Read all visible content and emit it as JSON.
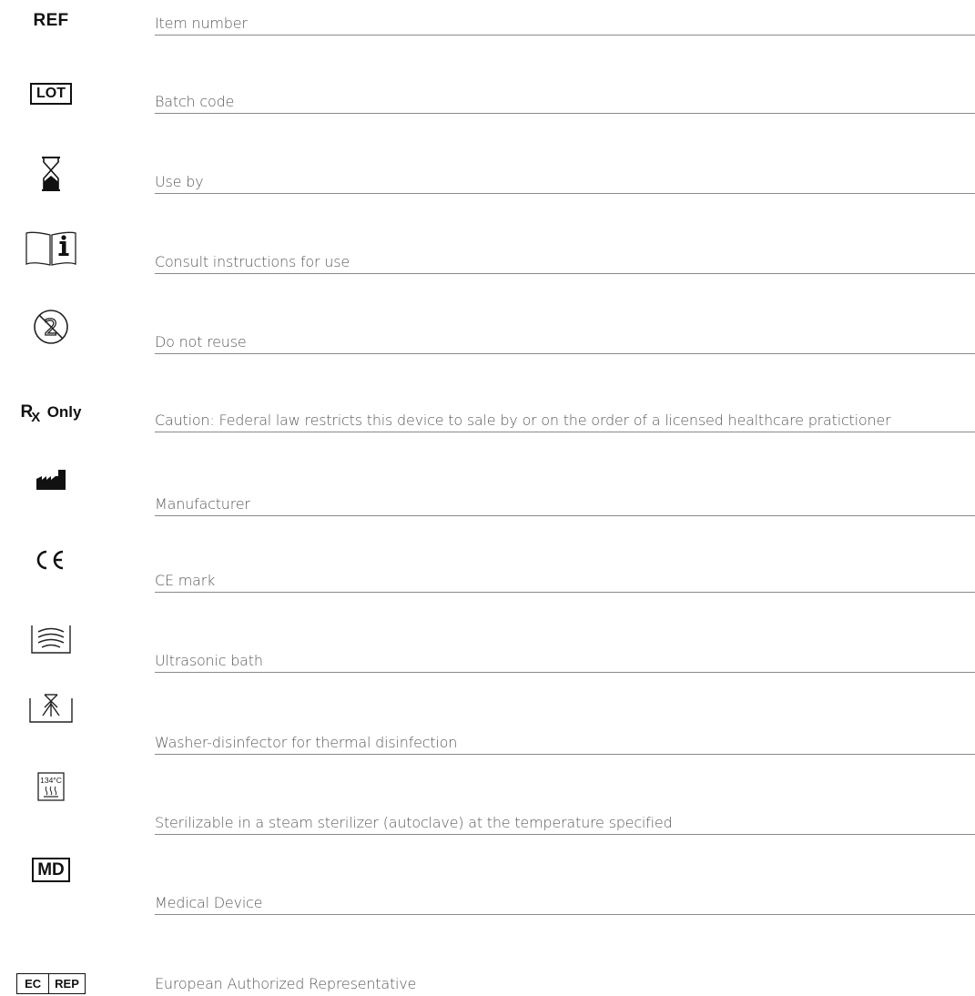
{
  "rows": [
    {
      "icon": "ref-symbol-icon",
      "symbol_text": "REF",
      "description": "Item number"
    },
    {
      "icon": "lot-symbol-icon",
      "symbol_text": "LOT",
      "description": "Batch code"
    },
    {
      "icon": "hourglass-icon",
      "description": "Use by"
    },
    {
      "icon": "instructions-book-icon",
      "description": "Consult instructions for use"
    },
    {
      "icon": "do-not-reuse-icon",
      "symbol_text": "2",
      "description": "Do not reuse"
    },
    {
      "icon": "rx-only-icon",
      "symbol_text": "R",
      "symbol_sub": "X",
      "symbol_suffix": "Only",
      "description": "Caution: Federal law restricts this device to sale by or on the order of a  licensed healthcare pratictioner"
    },
    {
      "icon": "factory-icon",
      "description": "Manufacturer"
    },
    {
      "icon": "ce-mark-icon",
      "symbol_text": "CE",
      "description": "CE mark"
    },
    {
      "icon": "ultrasonic-bath-icon",
      "description": "Ultrasonic bath"
    },
    {
      "icon": "washer-disinfector-icon",
      "description": "Washer-disinfector for thermal disinfection"
    },
    {
      "icon": "steam-sterilizer-icon",
      "symbol_text": "134°C",
      "description": "Sterilizable in a steam sterilizer (autoclave) at the temperature specified"
    },
    {
      "icon": "md-symbol-icon",
      "symbol_text": "MD",
      "description": "Medical Device"
    },
    {
      "icon": "ec-rep-symbol-icon",
      "symbol_text": "EC",
      "symbol_text_2": "REP",
      "description": "European Authorized Representative"
    }
  ]
}
